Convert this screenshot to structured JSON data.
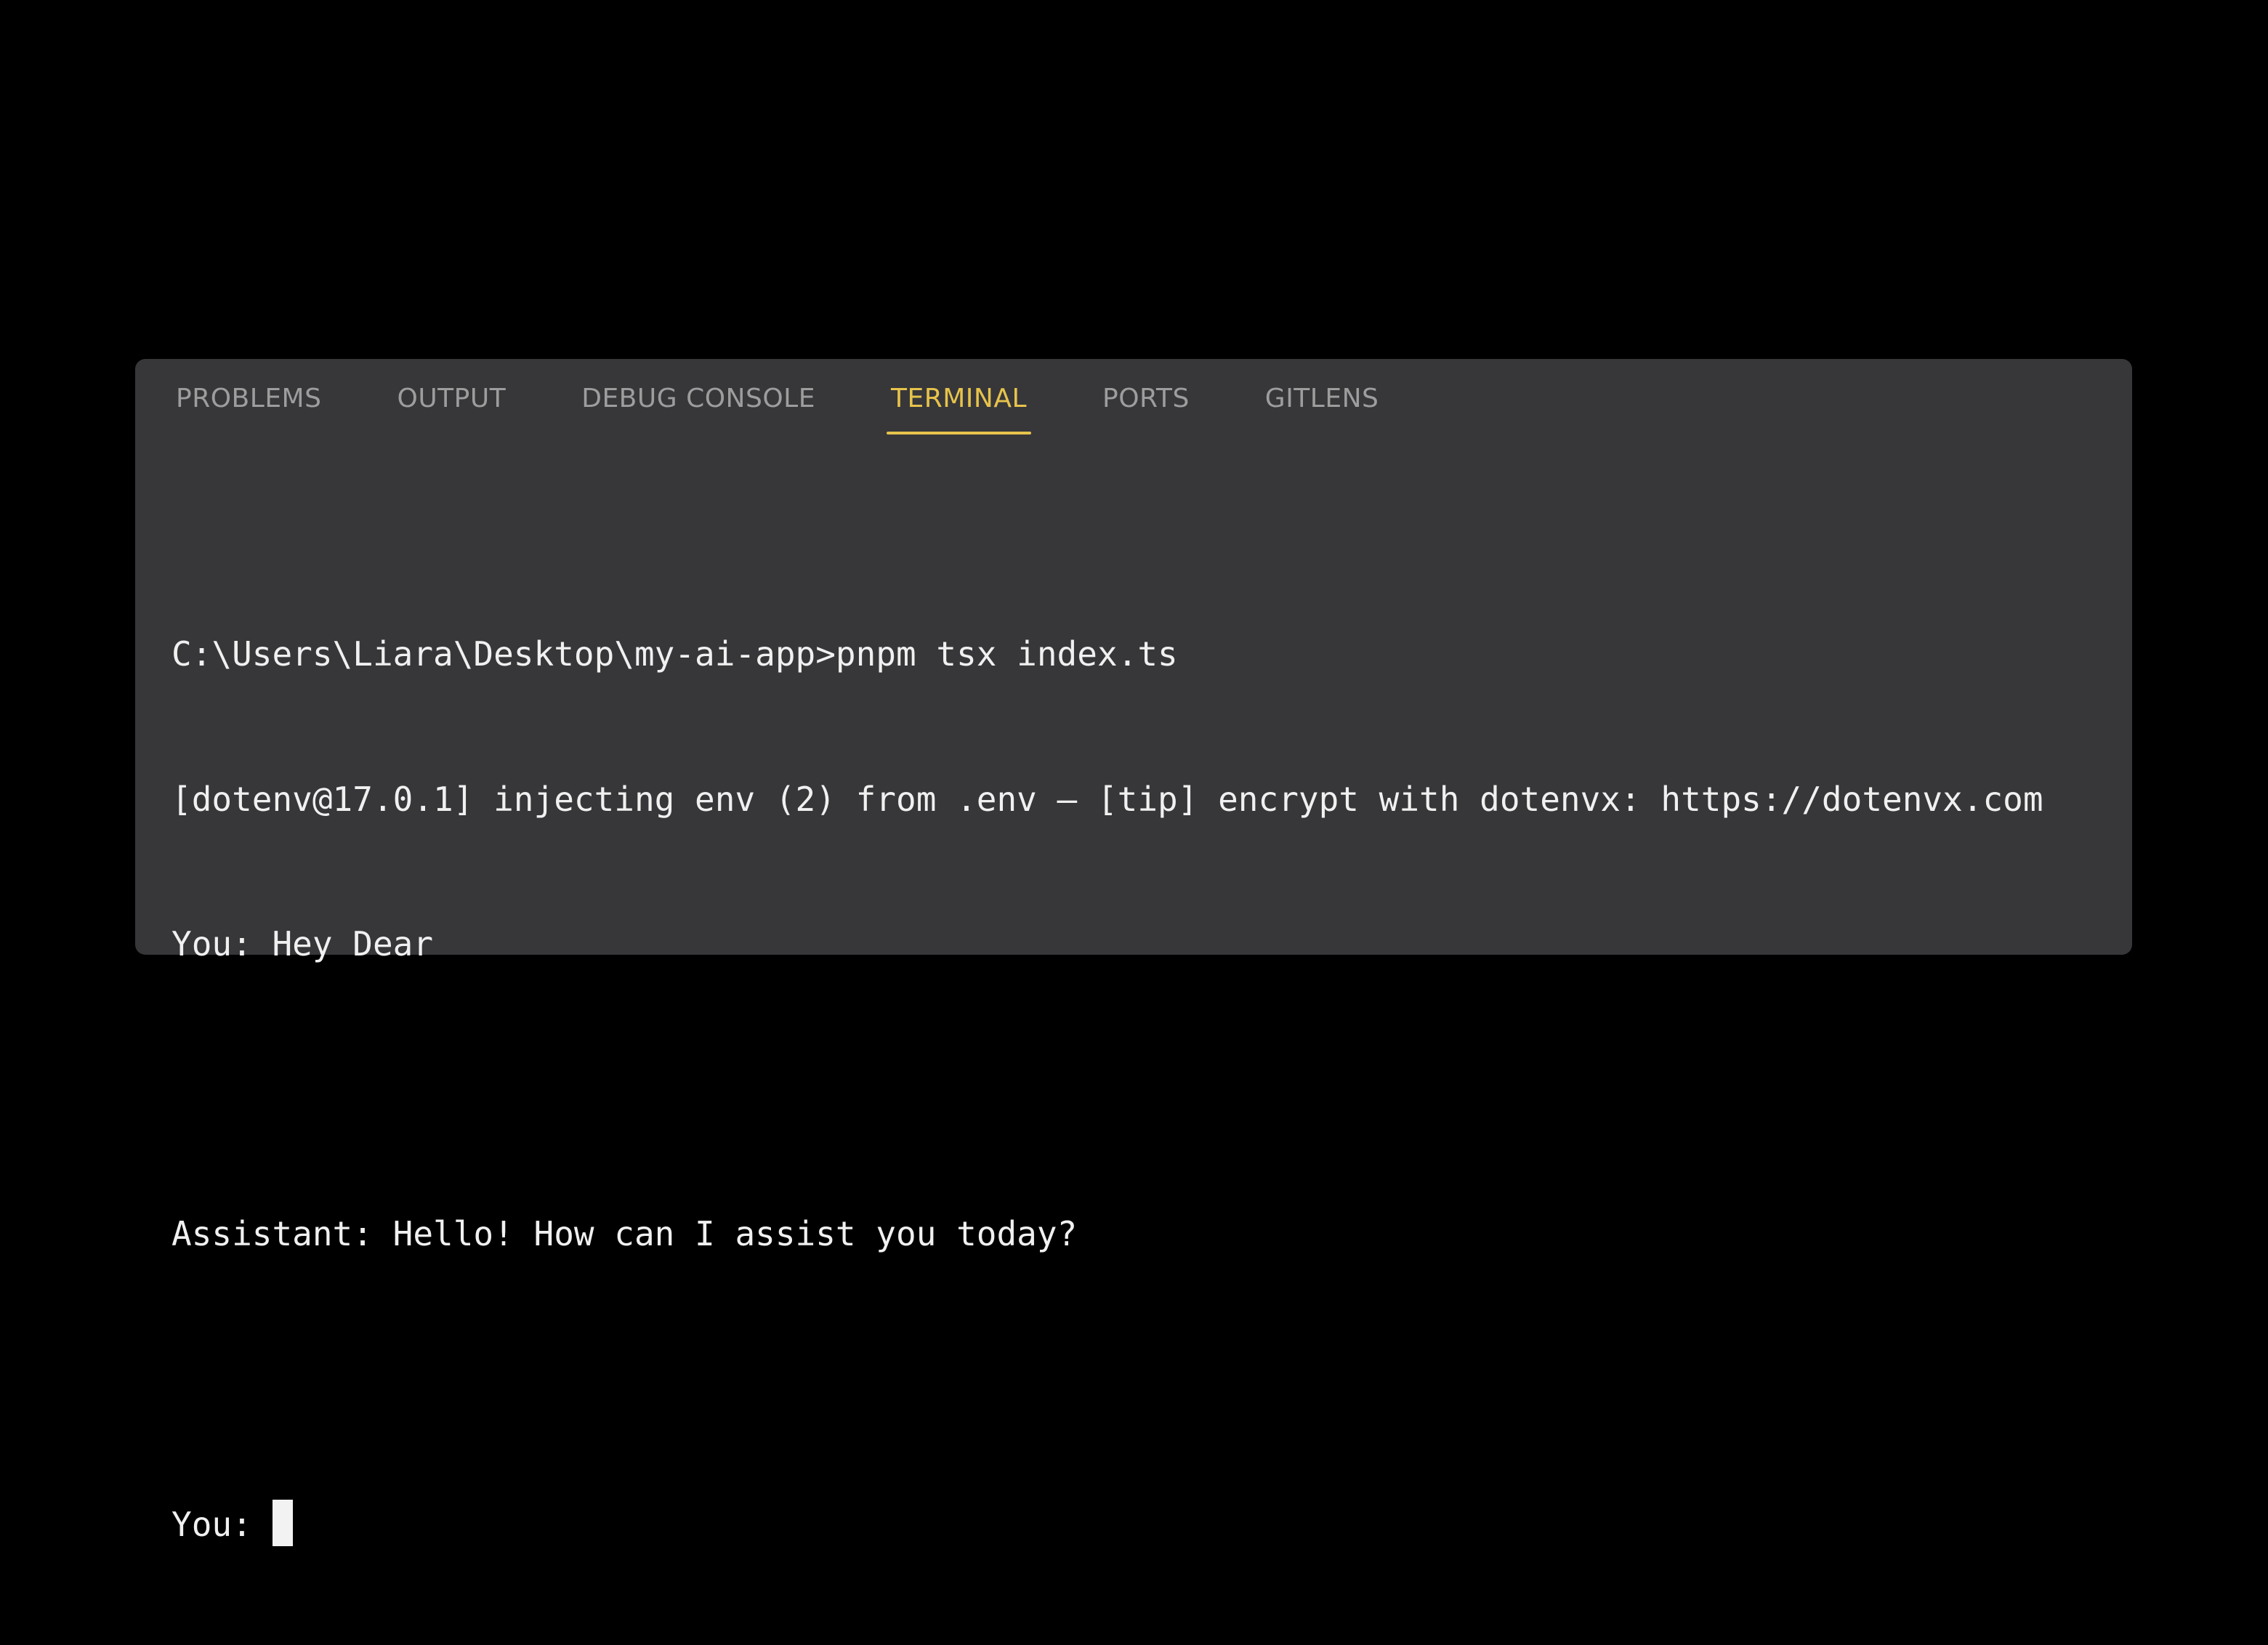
{
  "panel": {
    "tabs": [
      {
        "label": "PROBLEMS",
        "active": false
      },
      {
        "label": "OUTPUT",
        "active": false
      },
      {
        "label": "DEBUG CONSOLE",
        "active": false
      },
      {
        "label": "TERMINAL",
        "active": true
      },
      {
        "label": "PORTS",
        "active": false
      },
      {
        "label": "GITLENS",
        "active": false
      }
    ],
    "accent_color": "#e7c34b",
    "background_color": "#37373a"
  },
  "terminal": {
    "lines": [
      "C:\\Users\\Liara\\Desktop\\my-ai-app>pnpm tsx index.ts",
      "[dotenv@17.0.1] injecting env (2) from .env – [tip] encrypt with dotenvx: https://dotenvx.com",
      "You: Hey Dear",
      "",
      "Assistant: Hello! How can I assist you today?",
      "",
      "You:"
    ],
    "cursor": "block-cursor"
  }
}
